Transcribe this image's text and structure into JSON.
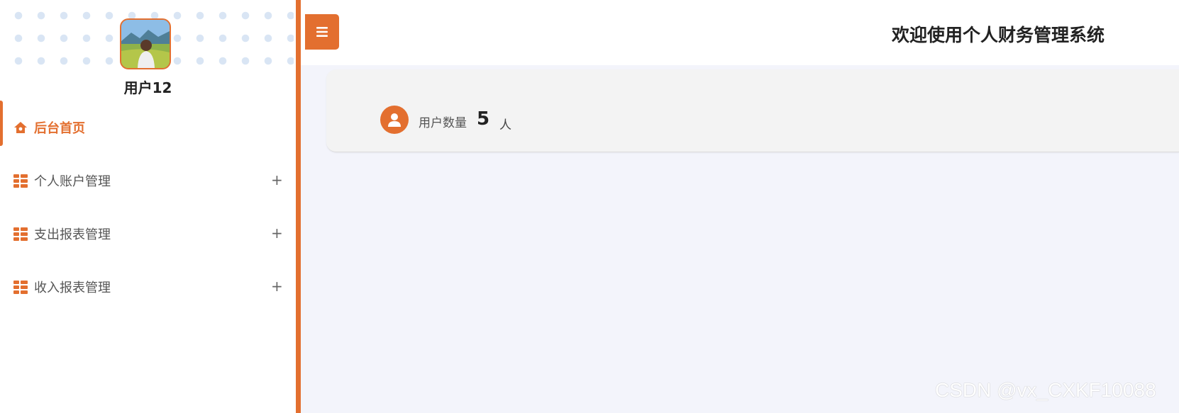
{
  "sidebar": {
    "username": "用户12",
    "items": [
      {
        "label": "后台首页",
        "icon": "home-icon",
        "active": true
      },
      {
        "label": "个人账户管理",
        "icon": "grid-menu-icon",
        "expand": "+"
      },
      {
        "label": "支出报表管理",
        "icon": "grid-menu-icon",
        "expand": "+"
      },
      {
        "label": "收入报表管理",
        "icon": "grid-menu-icon",
        "expand": "+"
      }
    ]
  },
  "header": {
    "title": "欢迎使用个人财务管理系统",
    "toggle_icon": "hamburger-icon"
  },
  "stats": {
    "user_count_label": "用户数量",
    "user_count_value": "5",
    "user_count_unit": "人",
    "icon": "user-icon"
  },
  "watermark": "CSDN @vx_CXKF10088",
  "colors": {
    "accent": "#e36f2f",
    "background": "#f3f4fb",
    "card": "#f3f3f3"
  }
}
